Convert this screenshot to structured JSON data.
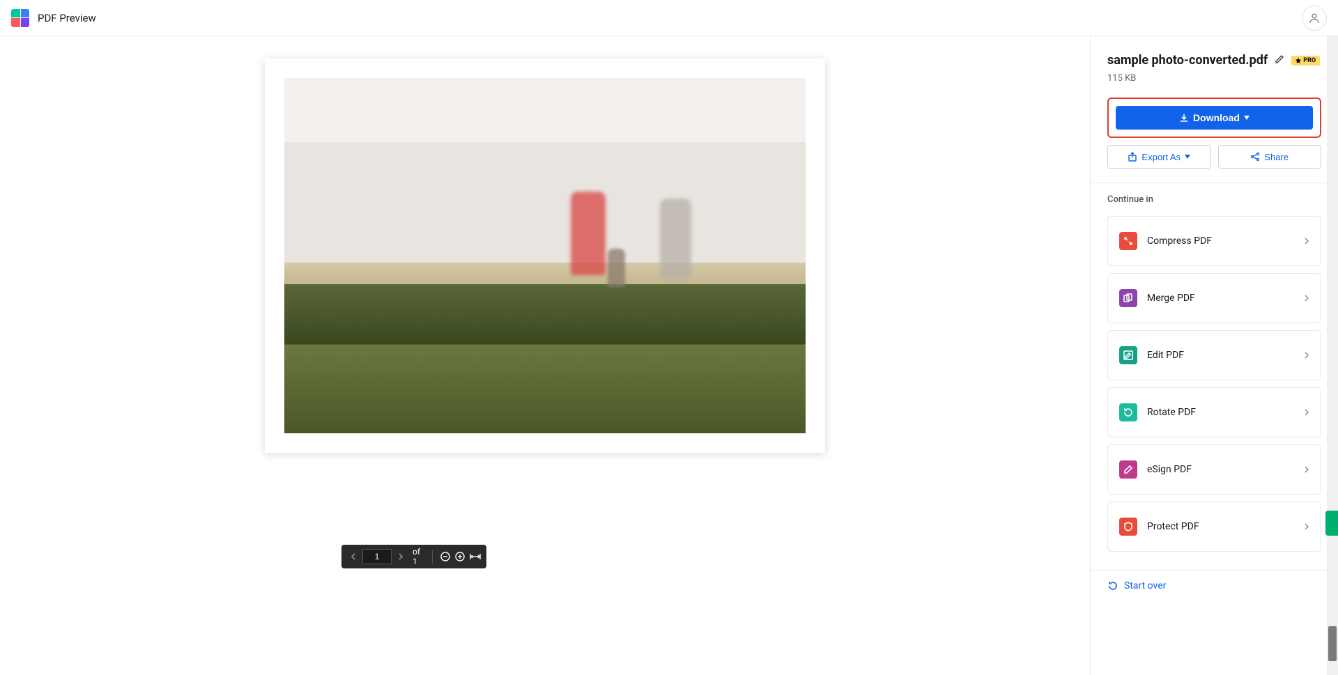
{
  "header": {
    "title": "PDF Preview"
  },
  "file": {
    "name": "sample photo-converted.pdf",
    "size": "115 KB"
  },
  "badges": {
    "pro": "PRO"
  },
  "buttons": {
    "download": "Download",
    "export_as": "Export As",
    "share": "Share"
  },
  "continue": {
    "heading": "Continue in",
    "tools": [
      {
        "label": "Compress PDF",
        "icon_color": "#e74c3c",
        "icon": "compress"
      },
      {
        "label": "Merge PDF",
        "icon_color": "#8e44ad",
        "icon": "merge"
      },
      {
        "label": "Edit PDF",
        "icon_color": "#16a085",
        "icon": "edit"
      },
      {
        "label": "Rotate PDF",
        "icon_color": "#1abc9c",
        "icon": "rotate"
      },
      {
        "label": "eSign PDF",
        "icon_color": "#c0398b",
        "icon": "esign"
      },
      {
        "label": "Protect PDF",
        "icon_color": "#e74c3c",
        "icon": "protect"
      }
    ]
  },
  "start_over": "Start over",
  "page_controls": {
    "current": "1",
    "total_label": "of 1"
  }
}
